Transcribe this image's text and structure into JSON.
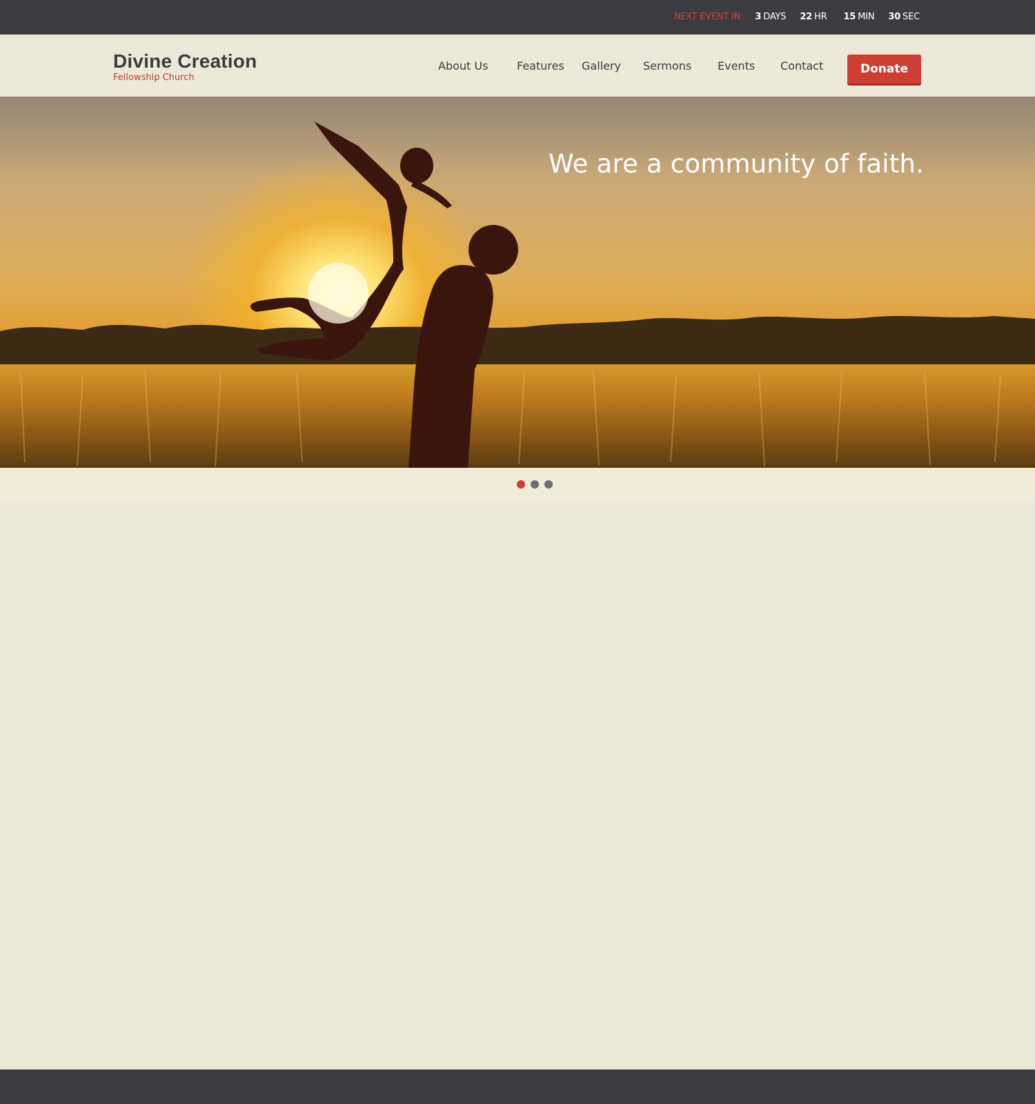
{
  "countdown": {
    "label": "NEXT EVENT IN:",
    "days_value": "3",
    "days_unit": "DAYS",
    "hours_value": "22",
    "hours_unit": "HR",
    "minutes_value": "15",
    "minutes_unit": "MIN",
    "seconds_value": "30",
    "seconds_unit": "SEC"
  },
  "logo": {
    "title": "Divine Creation",
    "subtitle": "Fellowship Church"
  },
  "nav": {
    "items": [
      "About Us",
      "Features",
      "Gallery",
      "Sermons",
      "Events",
      "Contact"
    ],
    "donate_label": "Donate"
  },
  "hero": {
    "caption": "We are a community of faith.",
    "slide_count": 3,
    "active_slide": 1
  },
  "colors": {
    "accent": "#cd3f35",
    "dark_bar": "#3b3c41",
    "background": "#ece9d8",
    "text": "#3b3c40"
  }
}
